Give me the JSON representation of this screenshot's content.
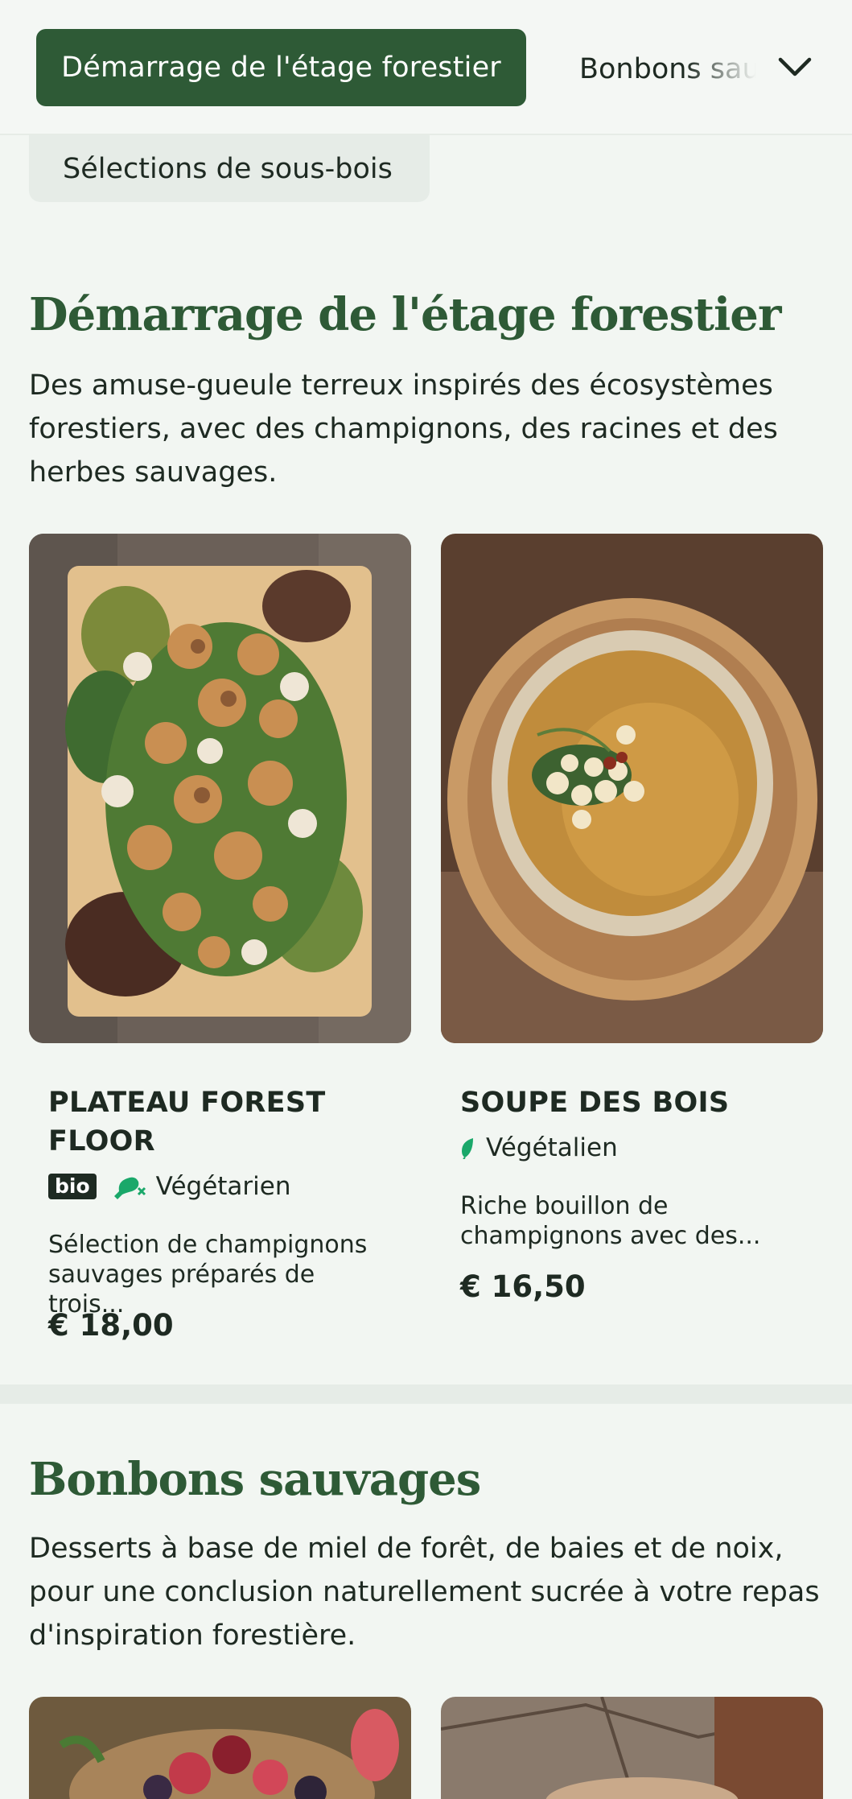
{
  "nav": {
    "active_tab": "Démarrage de l'étage forestier",
    "next_tab": "Bonbons sauvages",
    "sub_tab": "Sélections de sous-bois",
    "expand_icon": "chevron-down-icon"
  },
  "sections": [
    {
      "title": "Démarrage de l'étage forestier",
      "description": "Des amuse-gueule terreux inspirés des écosystèmes forestiers, avec des champignons, des racines et des herbes sauvages.",
      "items": [
        {
          "name": "PLATEAU FOREST FLOOR",
          "badge": "bio",
          "diet": "Végétarien",
          "diet_icon": "no-meat-icon",
          "description": "Sélection de champignons sauvages préparés de trois...",
          "price": "€ 18,00"
        },
        {
          "name": "SOUPE DES BOIS",
          "diet": "Végétalien",
          "diet_icon": "leaf-icon",
          "description": "Riche bouillon de champignons avec des...",
          "price": "€ 16,50"
        }
      ]
    },
    {
      "title": "Bonbons sauvages",
      "description": "Desserts à base de miel de forêt, de baies et de noix, pour une conclusion naturellement sucrée à votre repas d'inspiration forestière."
    }
  ],
  "colors": {
    "primary": "#2e5a36",
    "background": "#f2f6f2",
    "diet_green": "#1aa86a",
    "text": "#1e2a22"
  }
}
